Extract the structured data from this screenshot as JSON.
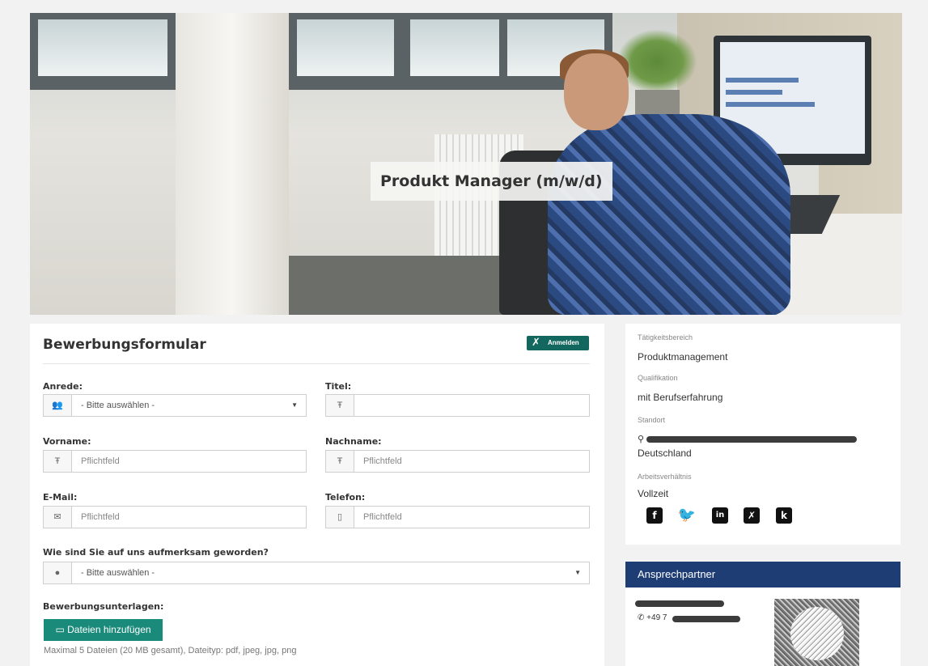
{
  "hero": {
    "title": "Produkt Manager (m/w/d)"
  },
  "form": {
    "title": "Bewerbungsformular",
    "xing_login_label": "Anmelden",
    "anrede": {
      "label": "Anrede:",
      "value": "- Bitte auswählen -"
    },
    "titel": {
      "label": "Titel:",
      "value": ""
    },
    "vorname": {
      "label": "Vorname:",
      "placeholder": "Pflichtfeld"
    },
    "nachname": {
      "label": "Nachname:",
      "placeholder": "Pflichtfeld"
    },
    "email": {
      "label": "E-Mail:",
      "placeholder": "Pflichtfeld"
    },
    "telefon": {
      "label": "Telefon:",
      "placeholder": "Pflichtfeld"
    },
    "source": {
      "label": "Wie sind Sie auf uns aufmerksam geworden?",
      "value": "- Bitte auswählen -"
    },
    "documents": {
      "label": "Bewerbungsunterlagen:",
      "button_label": "Dateien hinzufügen",
      "hint": "Maximal 5 Dateien (20 MB gesamt), Dateityp: pdf, jpeg, jpg, png"
    }
  },
  "info": {
    "area_caption": "Tätigkeitsbereich",
    "area_value": "Produktmanagement",
    "qualification_caption": "Qualifikation",
    "qualification_value": "mit Berufserfahrung",
    "location_caption": "Standort",
    "location_country": "Deutschland",
    "employment_caption": "Arbeitsverhältnis",
    "employment_value": "Vollzeit",
    "social_icons": [
      "facebook-icon",
      "twitter-icon",
      "linkedin-icon",
      "xing-icon",
      "kununu-icon"
    ]
  },
  "contact": {
    "title": "Ansprechpartner",
    "phone_prefix": "+49 7"
  },
  "colors": {
    "accent_green": "#1a8a7a",
    "xing_green": "#12675e",
    "contact_header": "#1f3d75"
  }
}
